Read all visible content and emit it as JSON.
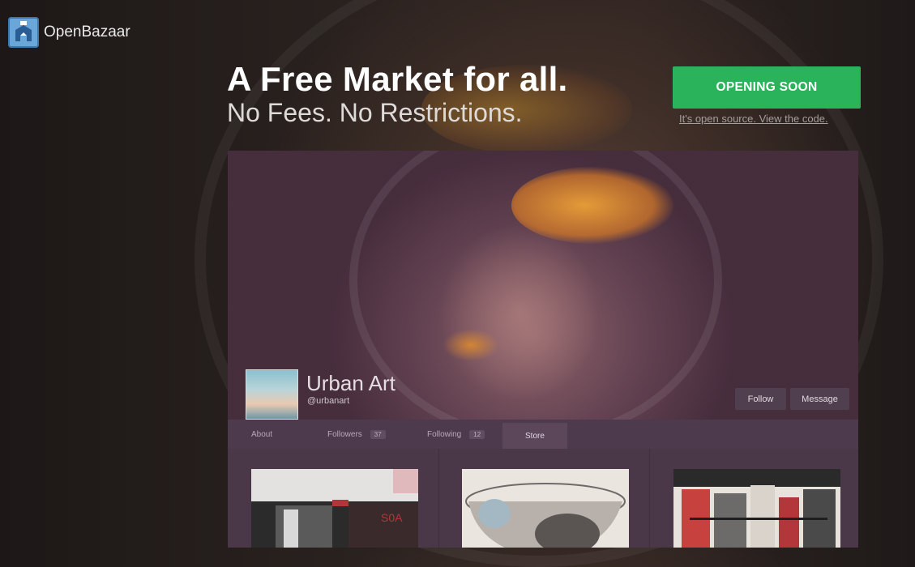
{
  "brand": {
    "name": "OpenBazaar",
    "logo_icon": "openbazaar-logo-icon"
  },
  "hero": {
    "headline": "A Free Market for all.",
    "subheadline": "No Fees. No Restrictions.",
    "cta_label": "OPENING SOON",
    "source_link": "It's open source. View the code."
  },
  "preview": {
    "store_name": "Urban Art",
    "store_handle": "@urbanart",
    "follow_label": "Follow",
    "message_label": "Message",
    "tabs": [
      {
        "label": "About"
      },
      {
        "label": "Followers",
        "count": "37"
      },
      {
        "label": "Following",
        "count": "12"
      },
      {
        "label": "Store"
      }
    ]
  },
  "colors": {
    "cta": "#2bb35c",
    "background": "#2a221f",
    "preview_panel": "#4e3a4d"
  }
}
